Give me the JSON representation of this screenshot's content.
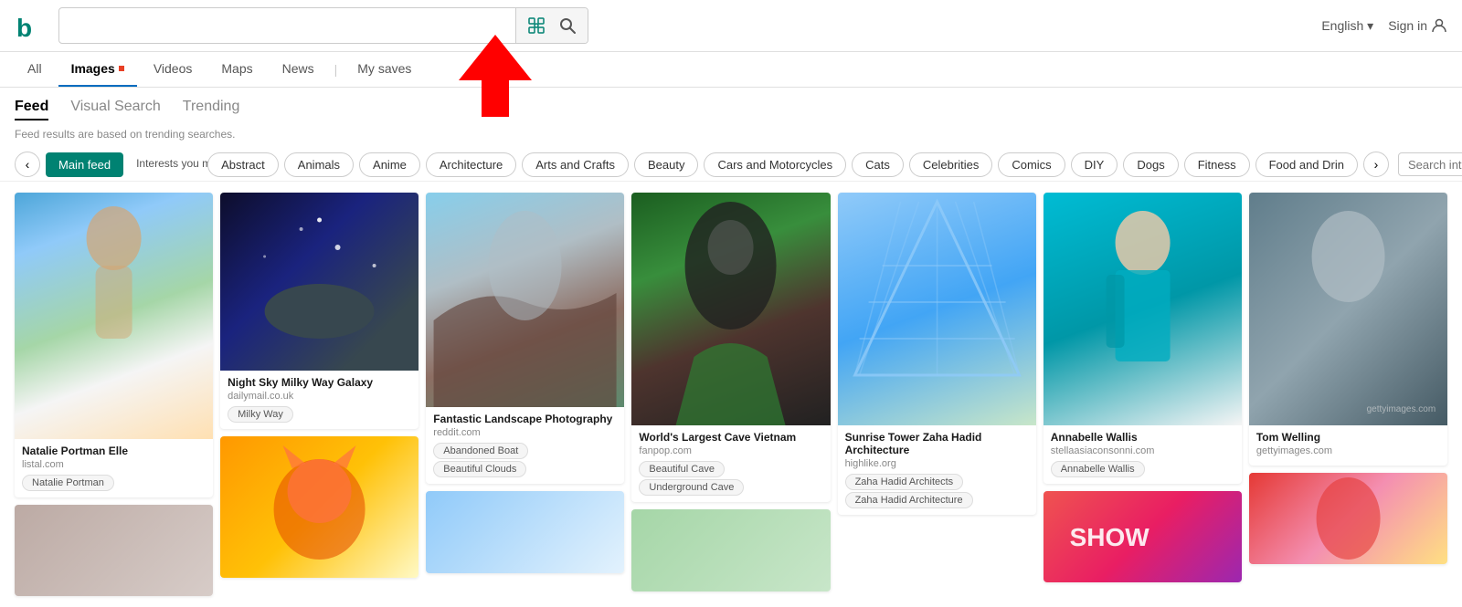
{
  "header": {
    "logo": "b",
    "search_placeholder": "",
    "search_value": "",
    "lang_label": "English",
    "lang_dropdown": "▾",
    "sign_in_label": "Sign in"
  },
  "nav": {
    "tabs": [
      {
        "id": "all",
        "label": "All",
        "active": false
      },
      {
        "id": "images",
        "label": "Images",
        "active": true,
        "dot": true
      },
      {
        "id": "videos",
        "label": "Videos",
        "active": false
      },
      {
        "id": "maps",
        "label": "Maps",
        "active": false
      },
      {
        "id": "news",
        "label": "News",
        "active": false
      },
      {
        "id": "mysaves",
        "label": "My saves",
        "active": false
      }
    ]
  },
  "feed_tabs": {
    "tabs": [
      {
        "id": "feed",
        "label": "Feed",
        "active": true
      },
      {
        "id": "visual",
        "label": "Visual Search",
        "active": false
      },
      {
        "id": "trending",
        "label": "Trending",
        "active": false
      }
    ],
    "subtitle": "Feed results are based on trending searches."
  },
  "interest_bar": {
    "main_feed_label": "Main feed",
    "interests_might_label": "Interests you might like",
    "tags": [
      "Abstract",
      "Animals",
      "Anime",
      "Architecture",
      "Arts and Crafts",
      "Beauty",
      "Cars and Motorcycles",
      "Cats",
      "Celebrities",
      "Comics",
      "DIY",
      "Dogs",
      "Fitness",
      "Food and Drin"
    ],
    "search_placeholder": "Search interests",
    "search_arrow": "→"
  },
  "images": {
    "col1": [
      {
        "id": "natalie",
        "title": "Natalie Portman Elle",
        "source": "listal.com",
        "tags": [
          "Natalie Portman"
        ],
        "height_class": "img-beach"
      },
      {
        "id": "room",
        "title": "",
        "source": "",
        "tags": [],
        "height_class": "img-room"
      }
    ],
    "col2": [
      {
        "id": "galaxy",
        "title": "Night Sky Milky Way Galaxy",
        "source": "dailymail.co.uk",
        "tags": [
          "Milky Way"
        ],
        "height_class": "img-galaxy"
      },
      {
        "id": "cat",
        "title": "",
        "source": "",
        "tags": [],
        "height_class": "img-cat"
      }
    ],
    "col3": [
      {
        "id": "landscape",
        "title": "Fantastic Landscape Photography",
        "source": "reddit.com",
        "tags": [
          "Abandoned Boat",
          "Beautiful Clouds"
        ],
        "height_class": "img-landscape"
      },
      {
        "id": "landscape2",
        "title": "",
        "source": "",
        "tags": [],
        "height_class": "img-cat"
      }
    ],
    "col4": [
      {
        "id": "cave",
        "title": "World's Largest Cave Vietnam",
        "source": "fanpop.com",
        "tags": [
          "Beautiful Cave",
          "Underground Cave"
        ],
        "height_class": "img-cave"
      },
      {
        "id": "cave2",
        "title": "",
        "source": "",
        "tags": [],
        "height_class": "img-cat"
      }
    ],
    "col5": [
      {
        "id": "building",
        "title": "Sunrise Tower Zaha Hadid Architecture",
        "source": "highlike.org",
        "tags": [
          "Zaha Hadid Architects",
          "Zaha Hadid Architecture"
        ],
        "height_class": "img-building"
      }
    ],
    "col6": [
      {
        "id": "woman_teal",
        "title": "Annabelle Wallis",
        "source": "stellaasiaconsonni.com",
        "tags": [
          "Annabelle Wallis"
        ],
        "height_class": "img-woman-teal"
      },
      {
        "id": "show",
        "title": "",
        "source": "",
        "tags": [],
        "height_class": "img-show"
      }
    ],
    "col7": [
      {
        "id": "man",
        "title": "Tom Welling",
        "source": "gettyimages.com",
        "tags": [],
        "height_class": "img-man"
      },
      {
        "id": "redhead",
        "title": "",
        "source": "",
        "tags": [],
        "height_class": "img-redhead"
      }
    ]
  }
}
